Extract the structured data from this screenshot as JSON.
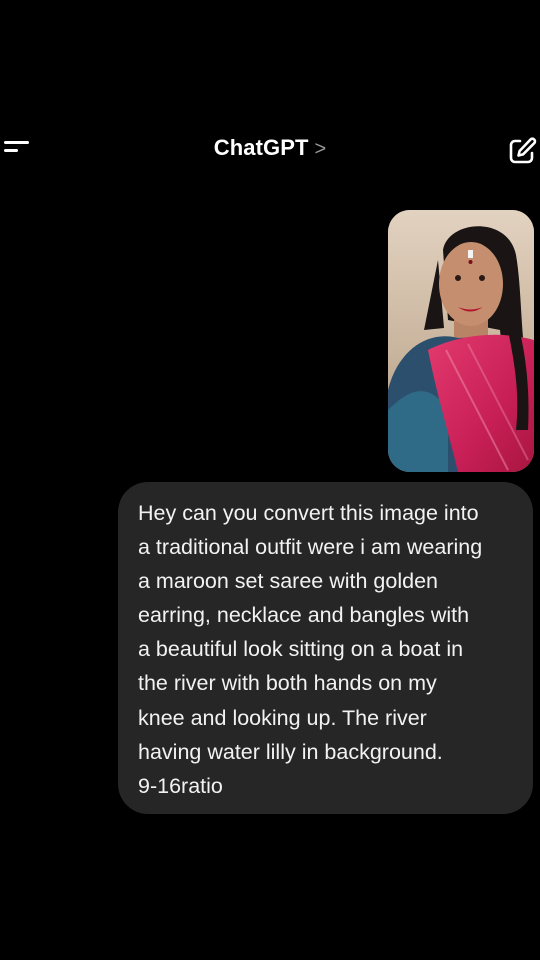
{
  "header": {
    "title": "ChatGPT",
    "chevron": ">",
    "menu_icon": "menu-icon",
    "new_chat_icon": "edit-icon"
  },
  "message": {
    "attachment": "user-photo",
    "text": "Hey can you convert this image into\na traditional outfit were i am wearing\na maroon set saree with golden\nearring, necklace and bangles with\na beautiful look sitting on a boat in\nthe river with both hands on my\nknee and looking up. The river\nhaving water lilly in background.\n9-16ratio"
  },
  "colors": {
    "background": "#000000",
    "bubble": "#262626",
    "text": "#f2f2f2"
  }
}
